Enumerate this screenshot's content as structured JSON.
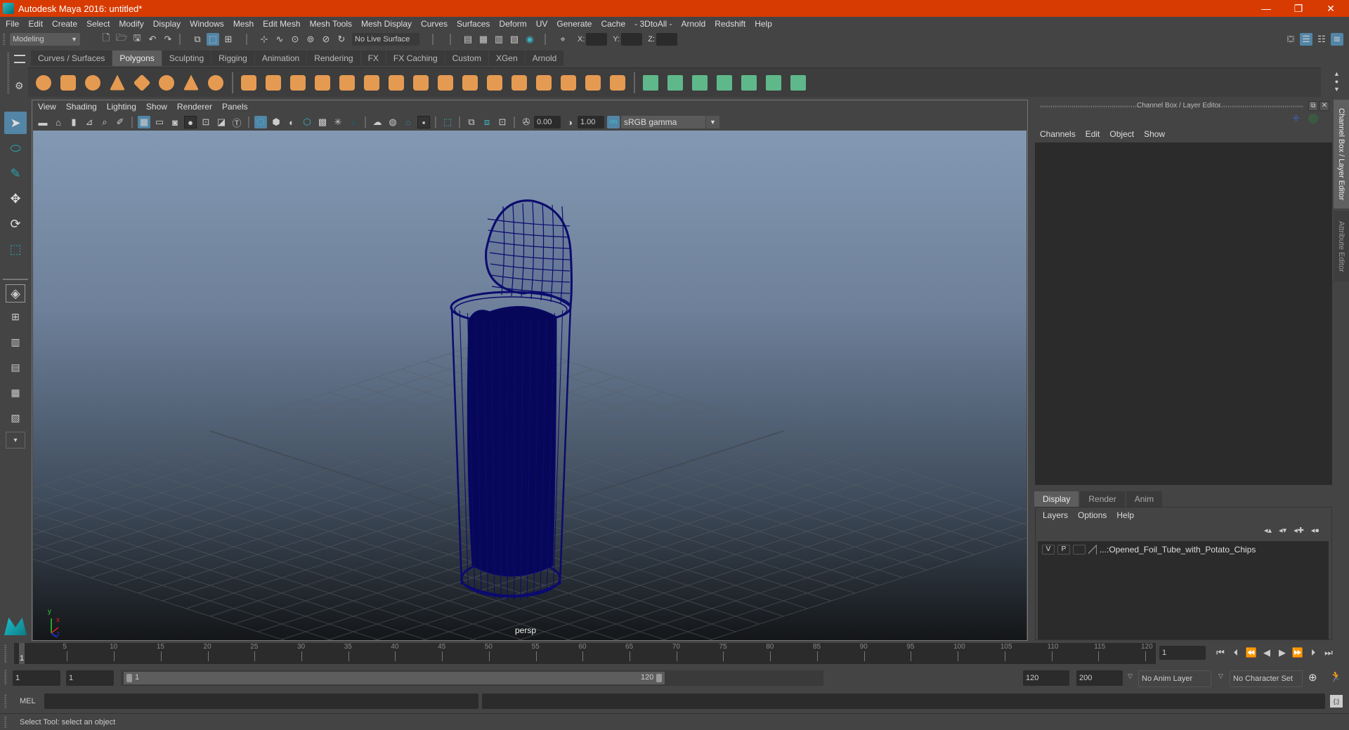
{
  "window": {
    "title": "Autodesk Maya 2016: untitled*",
    "controls": {
      "minimize": "—",
      "restore": "❐",
      "close": "✕"
    }
  },
  "menubar": [
    "File",
    "Edit",
    "Create",
    "Select",
    "Modify",
    "Display",
    "Windows",
    "Mesh",
    "Edit Mesh",
    "Mesh Tools",
    "Mesh Display",
    "Curves",
    "Surfaces",
    "Deform",
    "UV",
    "Generate",
    "Cache",
    "- 3DtoAll -",
    "Arnold",
    "Redshift",
    "Help"
  ],
  "statusline": {
    "mode": "Modeling",
    "live_surface": "No Live Surface",
    "coord_labels": {
      "x": "X:",
      "y": "Y:",
      "z": "Z:"
    },
    "coord_values": {
      "x": "",
      "y": "",
      "z": ""
    }
  },
  "shelf": {
    "tabs": [
      "Curves / Surfaces",
      "Polygons",
      "Sculpting",
      "Rigging",
      "Animation",
      "Rendering",
      "FX",
      "FX Caching",
      "Custom",
      "XGen",
      "Arnold"
    ],
    "active_tab": "Polygons",
    "poly_icons": [
      "poly-sphere-icon",
      "poly-cube-icon",
      "poly-cylinder-icon",
      "poly-cone-icon",
      "poly-platonic-icon",
      "poly-torus-icon",
      "poly-pyramid-icon",
      "poly-pipe-icon"
    ],
    "edit_icons": [
      "combine-icon",
      "separate-icon",
      "mirror-icon",
      "smooth-icon",
      "bevel-icon",
      "extrude-icon",
      "bridge-icon",
      "multicut-icon",
      "target-weld-icon",
      "fill-hole-icon",
      "make-live-icon",
      "edge-loop-icon",
      "insert-loop-icon",
      "merge-icon",
      "smooth-mesh-icon",
      "bool-icon"
    ],
    "uv_icons": [
      "planar-map-icon",
      "cylindrical-map-icon",
      "spherical-map-icon",
      "automatic-map-icon",
      "unfold-icon",
      "uv-editor-icon",
      "cut-sew-icon"
    ]
  },
  "viewport": {
    "menu": [
      "View",
      "Shading",
      "Lighting",
      "Show",
      "Renderer",
      "Panels"
    ],
    "exposure": "0.00",
    "gamma": "1.00",
    "color_mgmt": "ON",
    "colorspace": "sRGB gamma",
    "camera_label": "persp",
    "axis": {
      "x": "x",
      "y": "y",
      "z": "z"
    },
    "mesh_color": "#0b0b6e"
  },
  "channel_box": {
    "title": "Channel Box / Layer Editor",
    "menu": [
      "Channels",
      "Edit",
      "Object",
      "Show"
    ]
  },
  "layer_editor": {
    "tabs": [
      "Display",
      "Render",
      "Anim"
    ],
    "active_tab": "Display",
    "menu": [
      "Layers",
      "Options",
      "Help"
    ],
    "layers": [
      {
        "v": "V",
        "p": "P",
        "name": "...:Opened_Foil_Tube_with_Potato_Chips"
      }
    ]
  },
  "side_tabs": [
    "Channel Box / Layer Editor",
    "Attribute Editor"
  ],
  "timeline": {
    "ticks": [
      "5",
      "10",
      "15",
      "20",
      "25",
      "30",
      "35",
      "40",
      "45",
      "50",
      "55",
      "60",
      "65",
      "70",
      "75",
      "80",
      "85",
      "90",
      "95",
      "100",
      "105",
      "110",
      "115",
      "120"
    ],
    "current_frame_marker": "1",
    "current_frame": "1",
    "start": 1,
    "end": 120
  },
  "range": {
    "start_time": "1",
    "playback_start": "1",
    "slider_start": "1",
    "slider_end": "120",
    "playback_end": "120",
    "end_time": "200",
    "anim_layer": "No Anim Layer",
    "character_set": "No Character Set"
  },
  "mel": {
    "label": "MEL",
    "value": ""
  },
  "status": "Select Tool: select an object"
}
